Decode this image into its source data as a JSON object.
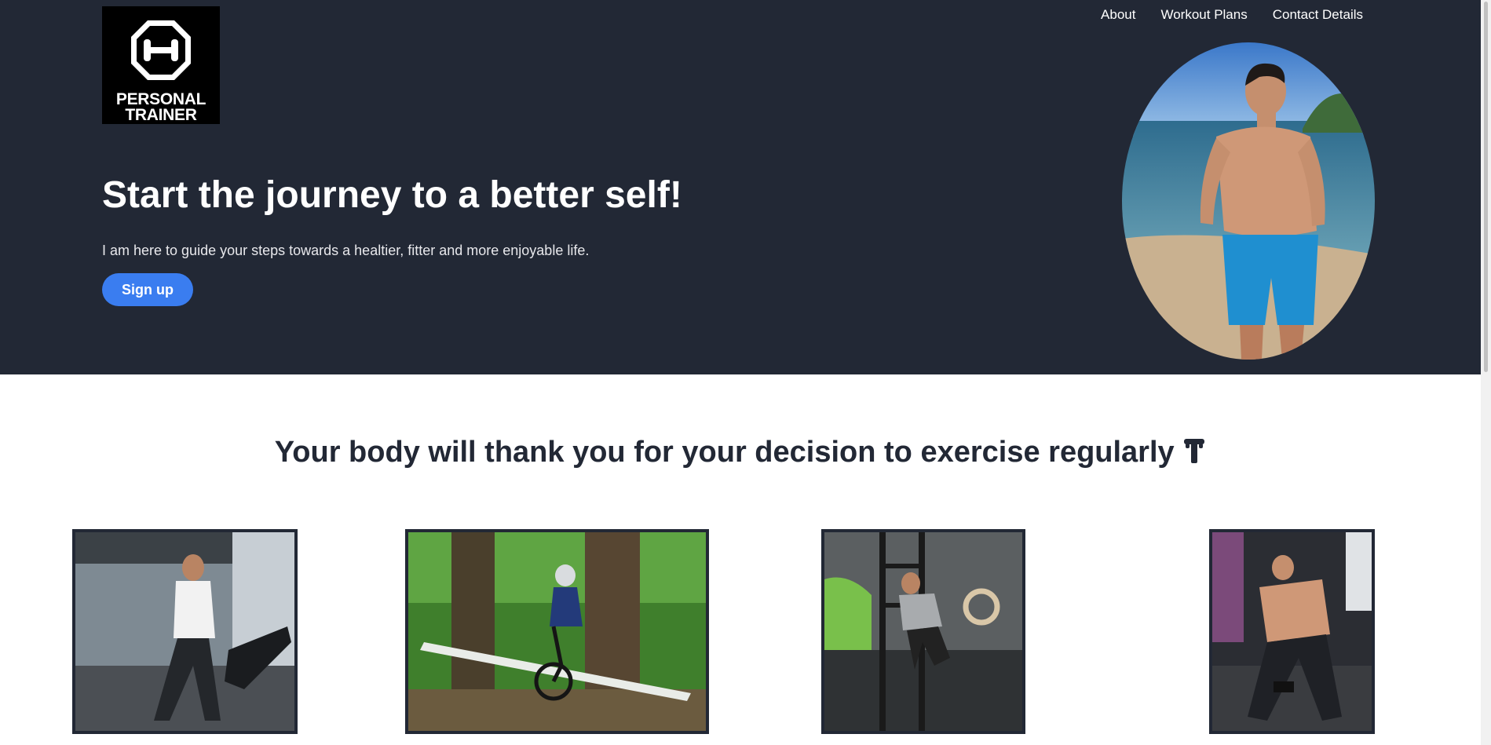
{
  "brand": {
    "logo_line1": "PERSONAL",
    "logo_line2": "TRAINER",
    "icon": "dumbbell-octagon-icon"
  },
  "nav": {
    "items": [
      {
        "label": "About"
      },
      {
        "label": "Workout Plans"
      },
      {
        "label": "Contact Details"
      }
    ]
  },
  "hero": {
    "title": "Start the journey to a better self!",
    "subtitle": "I am here to guide your steps towards a healtier, fitter and more enjoyable life.",
    "cta_label": "Sign up",
    "portrait_icon": "trainer-beach-photo"
  },
  "section": {
    "title": "Your body will thank you for your decision to exercise regularly",
    "title_icon": "kettlebell-icon"
  },
  "gallery": [
    {
      "icon": "treadmill-photo"
    },
    {
      "icon": "mountain-bike-photo"
    },
    {
      "icon": "gym-rings-photo"
    },
    {
      "icon": "dumbbell-row-photo"
    }
  ],
  "colors": {
    "hero_bg": "#222835",
    "accent": "#3a7df0",
    "text_dark": "#222835"
  }
}
